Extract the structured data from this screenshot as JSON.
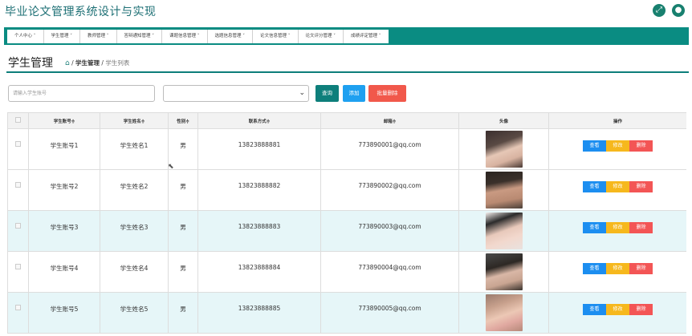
{
  "app": {
    "title": "毕业论文管理系统设计与实现",
    "top_icons": [
      "expand-icon",
      "user-icon"
    ]
  },
  "nav": {
    "items": [
      {
        "label": "个人中心 ˅",
        "name": "nav-item-personal-center"
      },
      {
        "label": "学生管理 ˅",
        "name": "nav-item-student-management"
      },
      {
        "label": "教师管理 ˅",
        "name": "nav-item-teacher-management"
      },
      {
        "label": "答辩通知管理 ˅",
        "name": "nav-item-defense-notice"
      },
      {
        "label": "课题信息管理 ˅",
        "name": "nav-item-topic-info"
      },
      {
        "label": "选题信息管理 ˅",
        "name": "nav-item-topic-selection"
      },
      {
        "label": "论文信息管理 ˅",
        "name": "nav-item-thesis-info"
      },
      {
        "label": "论文评分管理 ˅",
        "name": "nav-item-thesis-grading"
      },
      {
        "label": "成绩评定管理 ˅",
        "name": "nav-item-grade-evaluation"
      }
    ]
  },
  "page": {
    "title": "学生管理",
    "breadcrumb": {
      "sep": "/",
      "section": "学生管理",
      "current": "学生列表"
    }
  },
  "toolbar": {
    "search_placeholder": "请输入学生账号",
    "select_value": "",
    "query_label": "查询",
    "add_label": "添加",
    "batch_delete_label": "批量删除"
  },
  "table": {
    "headers": {
      "account": "学生账号≑",
      "name": "学生姓名≑",
      "gender": "性别≑",
      "phone": "联系方式≑",
      "email": "邮箱≑",
      "avatar": "头像",
      "actions": "操作"
    },
    "action_labels": {
      "view": "查看",
      "edit": "修改",
      "delete": "删除"
    },
    "rows": [
      {
        "account": "学生账号1",
        "name": "学生姓名1",
        "gender": "男",
        "phone": "13823888881",
        "email": "773890001@qq.com"
      },
      {
        "account": "学生账号2",
        "name": "学生姓名2",
        "gender": "男",
        "phone": "13823888882",
        "email": "773890002@qq.com"
      },
      {
        "account": "学生账号3",
        "name": "学生姓名3",
        "gender": "男",
        "phone": "13823888883",
        "email": "773890003@qq.com"
      },
      {
        "account": "学生账号4",
        "name": "学生姓名4",
        "gender": "男",
        "phone": "13823888884",
        "email": "773890004@qq.com"
      },
      {
        "account": "学生账号5",
        "name": "学生姓名5",
        "gender": "男",
        "phone": "13823888885",
        "email": "773890005@qq.com"
      }
    ]
  },
  "colors": {
    "accent": "#0a8c82",
    "title": "#1c6f74",
    "view": "#1c8ef0",
    "edit": "#f6b81d",
    "delete": "#f35555",
    "row_highlight": "#e6f6f8"
  }
}
